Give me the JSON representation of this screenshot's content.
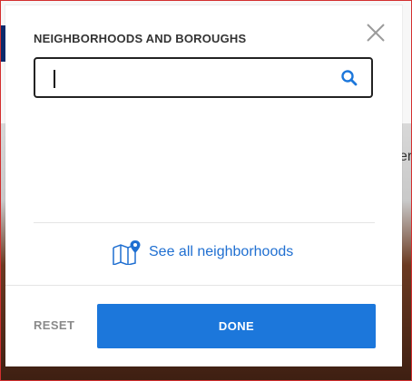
{
  "background": {
    "partial_text": "er"
  },
  "modal": {
    "title": "NEIGHBORHOODS AND BOROUGHS",
    "search": {
      "value": "",
      "placeholder": ""
    },
    "see_all_label": "See all neighborhoods",
    "reset_label": "RESET",
    "done_label": "DONE"
  },
  "colors": {
    "accent": "#1c77db",
    "link": "#1f6fd1",
    "muted": "#8a8a8a"
  },
  "icons": {
    "close": "close-icon",
    "search": "search-icon",
    "map": "map-pin-icon"
  }
}
